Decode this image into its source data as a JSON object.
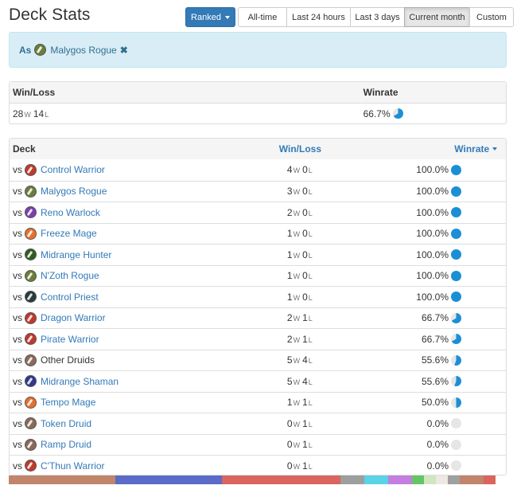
{
  "header": {
    "title": "Deck Stats"
  },
  "mode_button": {
    "label": "Ranked"
  },
  "time_filters": [
    {
      "label": "All-time",
      "active": false
    },
    {
      "label": "Last 24 hours",
      "active": false
    },
    {
      "label": "Last 3 days",
      "active": false
    },
    {
      "label": "Current month",
      "active": true
    },
    {
      "label": "Custom",
      "active": false
    }
  ],
  "filter": {
    "prefix": "As",
    "deck": "Malygos Rogue",
    "deck_icon": "rogue-icon",
    "remove_icon": "close-icon"
  },
  "summary": {
    "col_winloss": "Win/Loss",
    "col_winrate": "Winrate",
    "wins": "28",
    "losses": "14",
    "w_suffix": "W",
    "l_suffix": "L",
    "winrate": "66.7%",
    "winrate_value": 66.7
  },
  "decks_table": {
    "col_deck": "Deck",
    "col_winloss": "Win/Loss",
    "col_winrate": "Winrate",
    "vs": "vs",
    "rows": [
      {
        "deck": "Control Warrior",
        "cls": "warrior",
        "link": true,
        "w": "4",
        "l": "0",
        "winrate": "100.0%",
        "rate": 100
      },
      {
        "deck": "Malygos Rogue",
        "cls": "rogue",
        "link": true,
        "w": "3",
        "l": "0",
        "winrate": "100.0%",
        "rate": 100
      },
      {
        "deck": "Reno Warlock",
        "cls": "warlock",
        "link": true,
        "w": "2",
        "l": "0",
        "winrate": "100.0%",
        "rate": 100
      },
      {
        "deck": "Freeze Mage",
        "cls": "mage",
        "link": true,
        "w": "1",
        "l": "0",
        "winrate": "100.0%",
        "rate": 100
      },
      {
        "deck": "Midrange Hunter",
        "cls": "hunter",
        "link": true,
        "w": "1",
        "l": "0",
        "winrate": "100.0%",
        "rate": 100
      },
      {
        "deck": "N'Zoth Rogue",
        "cls": "rogue",
        "link": true,
        "w": "1",
        "l": "0",
        "winrate": "100.0%",
        "rate": 100
      },
      {
        "deck": "Control Priest",
        "cls": "priest",
        "link": true,
        "w": "1",
        "l": "0",
        "winrate": "100.0%",
        "rate": 100
      },
      {
        "deck": "Dragon Warrior",
        "cls": "warrior",
        "link": true,
        "w": "2",
        "l": "1",
        "winrate": "66.7%",
        "rate": 66.7
      },
      {
        "deck": "Pirate Warrior",
        "cls": "warrior",
        "link": true,
        "w": "2",
        "l": "1",
        "winrate": "66.7%",
        "rate": 66.7
      },
      {
        "deck": "Other Druids",
        "cls": "druid",
        "link": false,
        "w": "5",
        "l": "4",
        "winrate": "55.6%",
        "rate": 55.6
      },
      {
        "deck": "Midrange Shaman",
        "cls": "shaman",
        "link": true,
        "w": "5",
        "l": "4",
        "winrate": "55.6%",
        "rate": 55.6
      },
      {
        "deck": "Tempo Mage",
        "cls": "mage",
        "link": true,
        "w": "1",
        "l": "1",
        "winrate": "50.0%",
        "rate": 50
      },
      {
        "deck": "Token Druid",
        "cls": "druid",
        "link": true,
        "w": "0",
        "l": "1",
        "winrate": "0.0%",
        "rate": 0
      },
      {
        "deck": "Ramp Druid",
        "cls": "druid",
        "link": true,
        "w": "0",
        "l": "1",
        "winrate": "0.0%",
        "rate": 0
      },
      {
        "deck": "C'Thun Warrior",
        "cls": "warrior",
        "link": true,
        "w": "0",
        "l": "1",
        "winrate": "0.0%",
        "rate": 0
      }
    ]
  },
  "class_colors": {
    "warrior": "#c0392b",
    "rogue": "#6b7d3a",
    "warlock": "#7a3fb0",
    "mage": "#e8702a",
    "hunter": "#2e5e1f",
    "priest": "#2a3a3a",
    "druid": "#8a6a5a",
    "shaman": "#2e3a8a"
  },
  "pie_colors": {
    "fill": "#1b8fd6",
    "empty": "#e6e6e6"
  },
  "distribution_bar": [
    {
      "color": "#c0856a",
      "share": 0.214
    },
    {
      "color": "#5b6bc7",
      "share": 0.214
    },
    {
      "color": "#d9655e",
      "share": 0.238
    },
    {
      "color": "#9e9e9e",
      "share": 0.048
    },
    {
      "color": "#5bd3e6",
      "share": 0.048
    },
    {
      "color": "#c27fe0",
      "share": 0.048
    },
    {
      "color": "#63c563",
      "share": 0.024
    },
    {
      "color": "#d0e6c0",
      "share": 0.024
    },
    {
      "color": "#ece8e2",
      "share": 0.024
    },
    {
      "color": "#a0a0a0",
      "share": 0.024
    },
    {
      "color": "#c0856a",
      "share": 0.048
    },
    {
      "color": "#d9655e",
      "share": 0.024
    }
  ]
}
